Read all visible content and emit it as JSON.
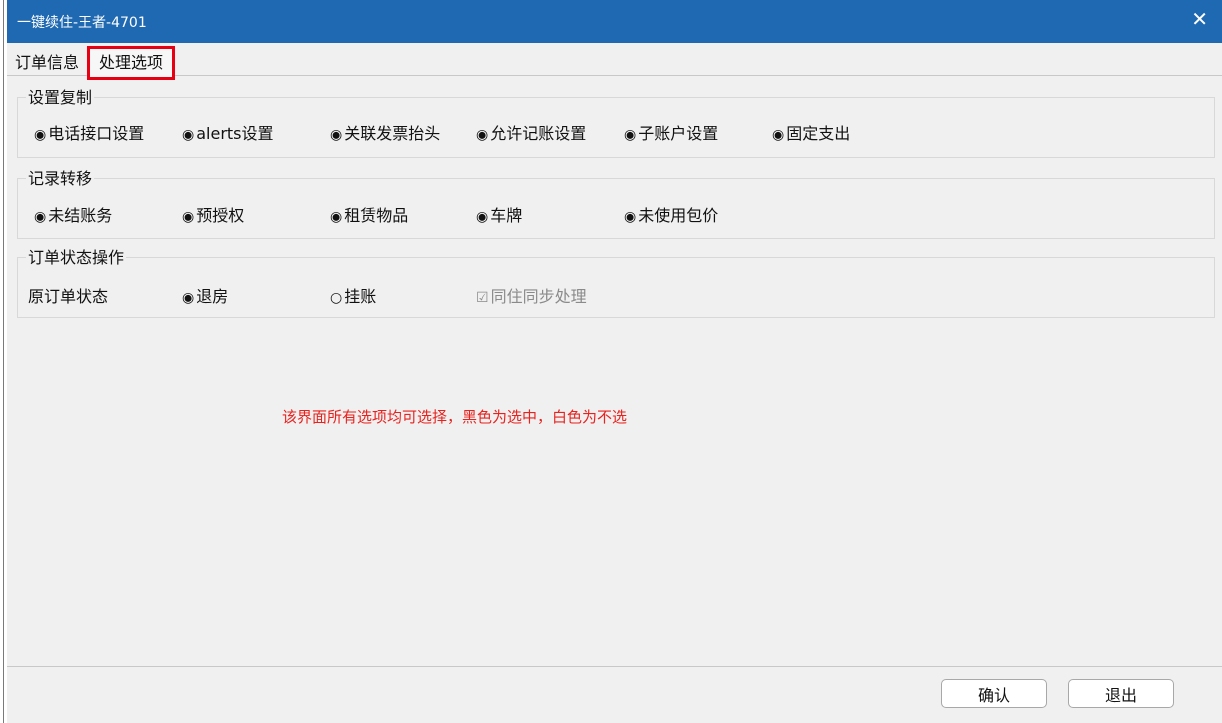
{
  "window": {
    "title": "一键续住-王者-4701",
    "close_glyph": "✕"
  },
  "tabs": [
    {
      "label": "订单信息"
    },
    {
      "label": "处理选项"
    }
  ],
  "radio_marks": {
    "checked": "◉",
    "unchecked": "○",
    "checkbox_checked": "☑"
  },
  "group_copy": {
    "title": "设置复制",
    "options": [
      "电话接口设置",
      "alerts设置",
      "关联发票抬头",
      "允许记账设置",
      "子账户设置",
      "固定支出"
    ]
  },
  "group_transfer": {
    "title": "记录转移",
    "options": [
      "未结账务",
      "预授权",
      "租赁物品",
      "车牌",
      "未使用包价"
    ]
  },
  "group_status": {
    "title": "订单状态操作",
    "original_label": "原订单状态",
    "checkout_label": "退房",
    "hang_label": "挂账",
    "sync_label": "同住同步处理"
  },
  "note": "该界面所有选项均可选择，黑色为选中，白色为不选",
  "buttons": {
    "ok": "确认",
    "exit": "退出"
  },
  "colors": {
    "titlebar": "#1f68b2",
    "highlight_border": "#e60012",
    "note_text": "#e8221e"
  }
}
